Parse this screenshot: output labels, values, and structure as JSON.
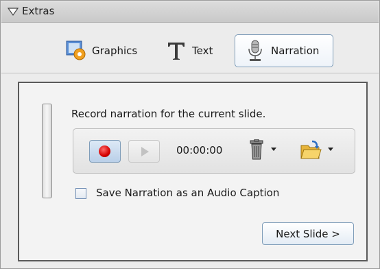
{
  "panel": {
    "title": "Extras"
  },
  "tabs": [
    {
      "label": "Graphics",
      "icon": "graphics-icon"
    },
    {
      "label": "Text",
      "icon": "text-icon"
    },
    {
      "label": "Narration",
      "icon": "microphone-icon",
      "selected": true
    }
  ],
  "narration": {
    "instruction": "Record narration for the current slide.",
    "timer": "00:00:00",
    "save_caption_label": "Save Narration as an Audio Caption",
    "save_caption_checked": false,
    "next_button": "Next Slide >"
  },
  "colors": {
    "accent_border": "#7f9db9",
    "record_red": "#d40000"
  }
}
